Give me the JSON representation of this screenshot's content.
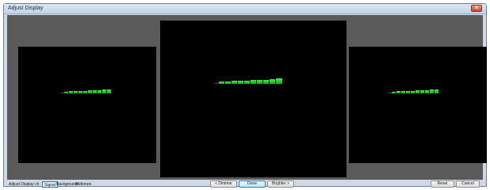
{
  "window": {
    "title": "Adjust Display",
    "close_label": "✕"
  },
  "footer": {
    "adjust_label": "Adjust Display ch",
    "tabs": [
      {
        "label": "Signal",
        "selected": true
      },
      {
        "label": "Background",
        "selected": false
      },
      {
        "label": "Midtones",
        "selected": false
      }
    ],
    "dimmer_label": "< Dimmer",
    "done_label": "Done",
    "brighter_label": "Brighter >",
    "reset_label": "Reset",
    "cancel_label": "Cancel"
  },
  "colors": {
    "band": "#3cf53c",
    "panel_bg": "#000000",
    "client_bg": "#5a5a5a"
  },
  "icons": {
    "close": "close-icon"
  }
}
